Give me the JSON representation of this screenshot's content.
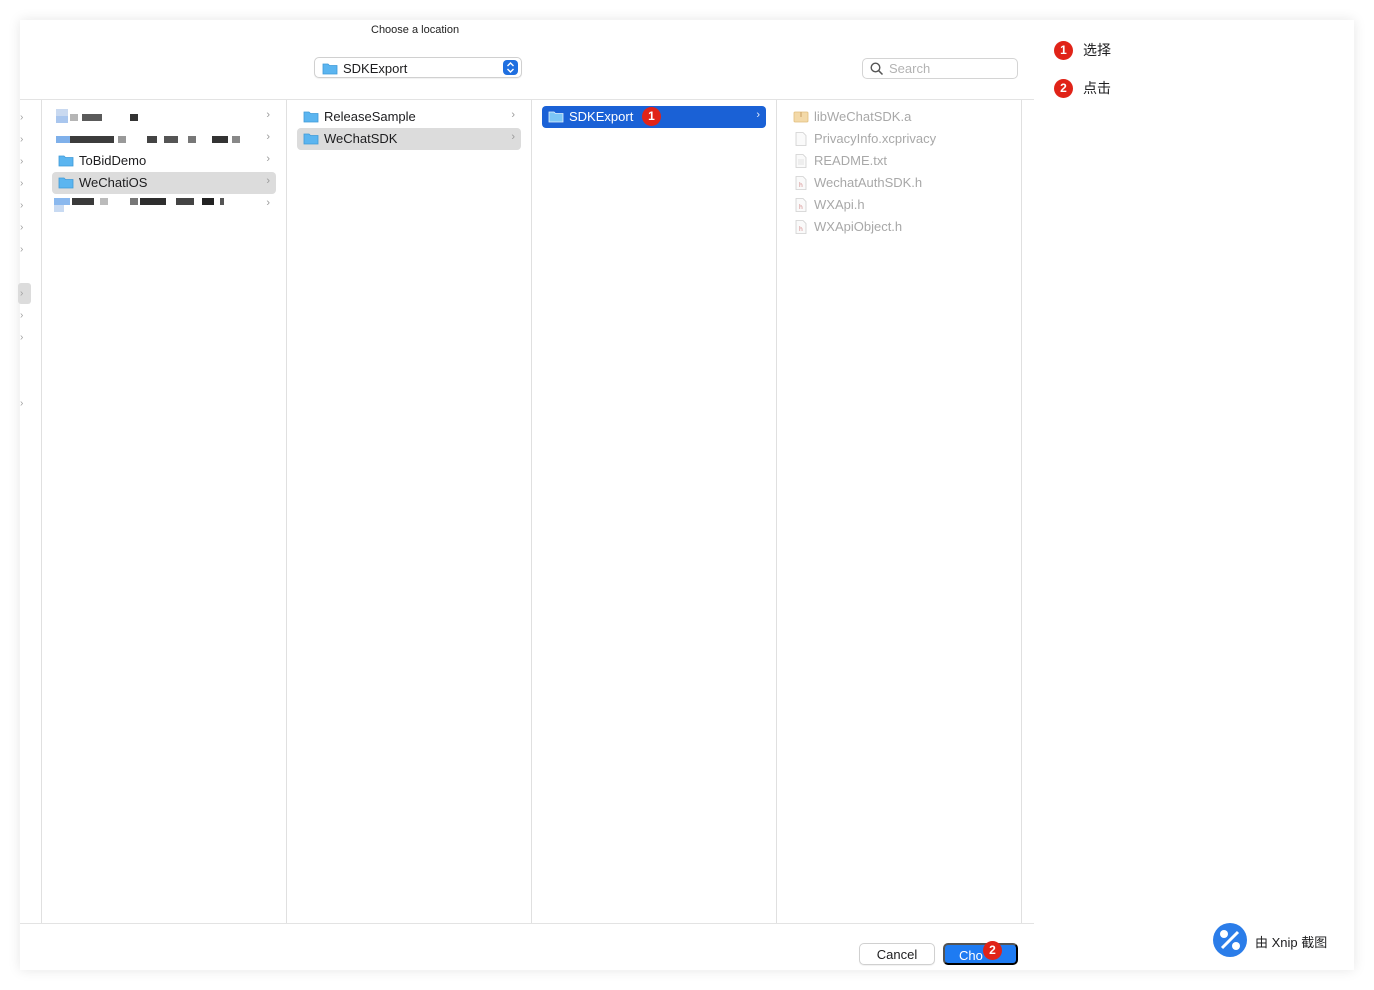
{
  "dialog": {
    "title": "Choose a location"
  },
  "location": {
    "selected": "SDKExport"
  },
  "search": {
    "placeholder": "Search"
  },
  "column1": {
    "items": [
      {
        "name": "ToBidDemo"
      },
      {
        "name": "WeChatiOS"
      }
    ]
  },
  "column2": {
    "items": [
      {
        "name": "ReleaseSample"
      },
      {
        "name": "WeChatSDK"
      }
    ]
  },
  "column3": {
    "items": [
      {
        "name": "SDKExport"
      }
    ]
  },
  "column4": {
    "items": [
      {
        "name": "libWeChatSDK.a",
        "icon": "archive-file-icon"
      },
      {
        "name": "PrivacyInfo.xcprivacy",
        "icon": "document-icon"
      },
      {
        "name": "README.txt",
        "icon": "text-file-icon"
      },
      {
        "name": "WechatAuthSDK.h",
        "icon": "header-file-icon"
      },
      {
        "name": "WXApi.h",
        "icon": "header-file-icon"
      },
      {
        "name": "WXApiObject.h",
        "icon": "header-file-icon"
      }
    ]
  },
  "buttons": {
    "cancel": "Cancel",
    "choose": "Cho"
  },
  "annotations": {
    "step1_number": "1",
    "step1_label": "选择",
    "step2_number": "2",
    "step2_label": "点击"
  },
  "watermark": {
    "text": "由 Xnip 截图"
  },
  "colors": {
    "accent": "#1a61d6",
    "button_primary": "#1e7bf2",
    "badge": "#e02318",
    "folder": "#5bb5f0",
    "selection_gray": "#dcdcdc"
  }
}
